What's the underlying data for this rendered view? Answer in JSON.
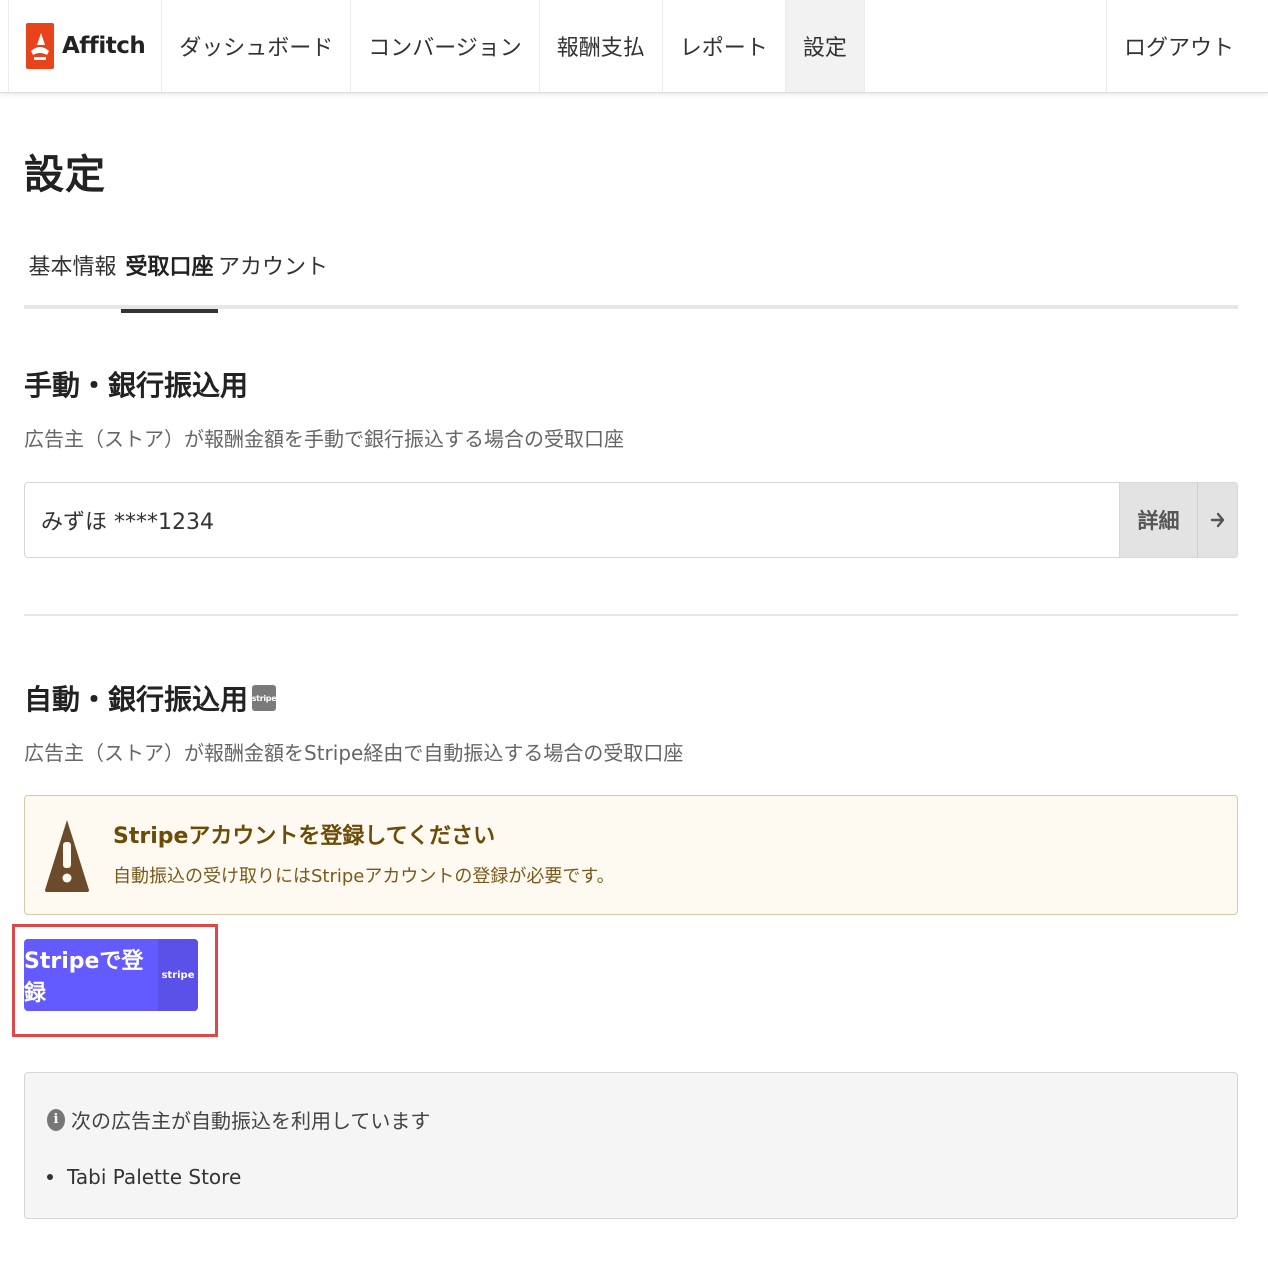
{
  "nav": {
    "brand": "Affitch",
    "items": [
      "ダッシュボード",
      "コンバージョン",
      "報酬支払",
      "レポート",
      "設定"
    ],
    "active_index": 4,
    "logout": "ログアウト"
  },
  "page": {
    "title": "設定"
  },
  "tabs": {
    "items": [
      "基本情報",
      "受取口座",
      "アカウント"
    ],
    "active_index": 1
  },
  "manual": {
    "title": "手動・銀行振込用",
    "description": "広告主（ストア）が報酬金額を手動で銀行振込する場合の受取口座",
    "account_value": "みずほ ****1234",
    "detail_label": "詳細"
  },
  "auto": {
    "title": "自動・銀行振込用",
    "badge": "stripe",
    "description": "広告主（ストア）が報酬金額をStripe経由で自動振込する場合の受取口座",
    "warning_title": "Stripeアカウントを登録してください",
    "warning_text": "自動振込の受け取りにはStripeアカウントの登録が必要です。",
    "register_button": "Stripeで登録",
    "register_badge": "stripe",
    "info_text": "次の広告主が自動振込を利用しています",
    "advertisers": [
      "Tabi Palette Store"
    ]
  },
  "colors": {
    "brand": "#e8431b",
    "stripe": "#635bff",
    "warning_bg": "#fffaf1",
    "highlight": "#e04848"
  }
}
